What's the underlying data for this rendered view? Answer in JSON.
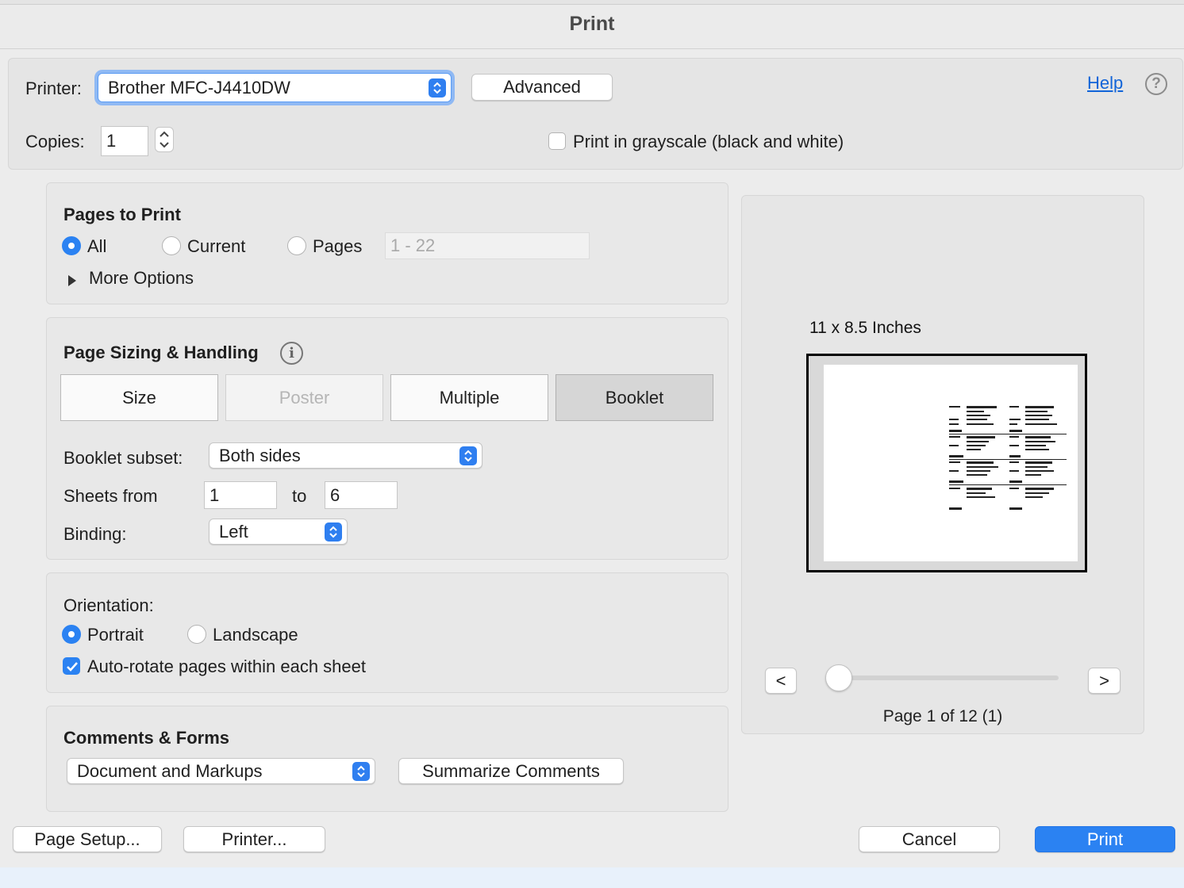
{
  "window": {
    "title": "Print"
  },
  "printer": {
    "label": "Printer:",
    "selected": "Brother MFC-J4410DW",
    "advanced_label": "Advanced",
    "help_label": "Help",
    "help_icon": "?"
  },
  "copies": {
    "label": "Copies:",
    "value": "1"
  },
  "grayscale": {
    "label": "Print in grayscale (black and white)",
    "checked": false
  },
  "pages_to_print": {
    "heading": "Pages to Print",
    "options": [
      "All",
      "Current",
      "Pages"
    ],
    "selected": "All",
    "range_placeholder": "1 - 22",
    "more_options_label": "More Options"
  },
  "page_sizing": {
    "heading": "Page Sizing & Handling",
    "info_icon": "i",
    "tabs": [
      "Size",
      "Poster",
      "Multiple",
      "Booklet"
    ],
    "selected_tab": "Booklet",
    "disabled_tab": "Poster",
    "booklet_subset_label": "Booklet subset:",
    "booklet_subset_value": "Both sides",
    "sheets_from_label": "Sheets from",
    "sheets_from_value": "1",
    "to_label": "to",
    "sheets_to_value": "6",
    "binding_label": "Binding:",
    "binding_value": "Left"
  },
  "orientation": {
    "heading": "Orientation:",
    "options": [
      "Portrait",
      "Landscape"
    ],
    "selected": "Portrait",
    "auto_rotate_label": "Auto-rotate pages within each sheet",
    "auto_rotate_checked": true
  },
  "comments_forms": {
    "heading": "Comments & Forms",
    "value": "Document and Markups",
    "summarize_label": "Summarize Comments"
  },
  "preview": {
    "size_label": "11 x 8.5 Inches",
    "prev_label": "<",
    "next_label": ">",
    "page_status": "Page 1 of 12 (1)"
  },
  "footer": {
    "page_setup_label": "Page Setup...",
    "printer_label": "Printer...",
    "cancel_label": "Cancel",
    "print_label": "Print"
  },
  "colors": {
    "accent": "#2b82f2",
    "link": "#1164d8"
  }
}
